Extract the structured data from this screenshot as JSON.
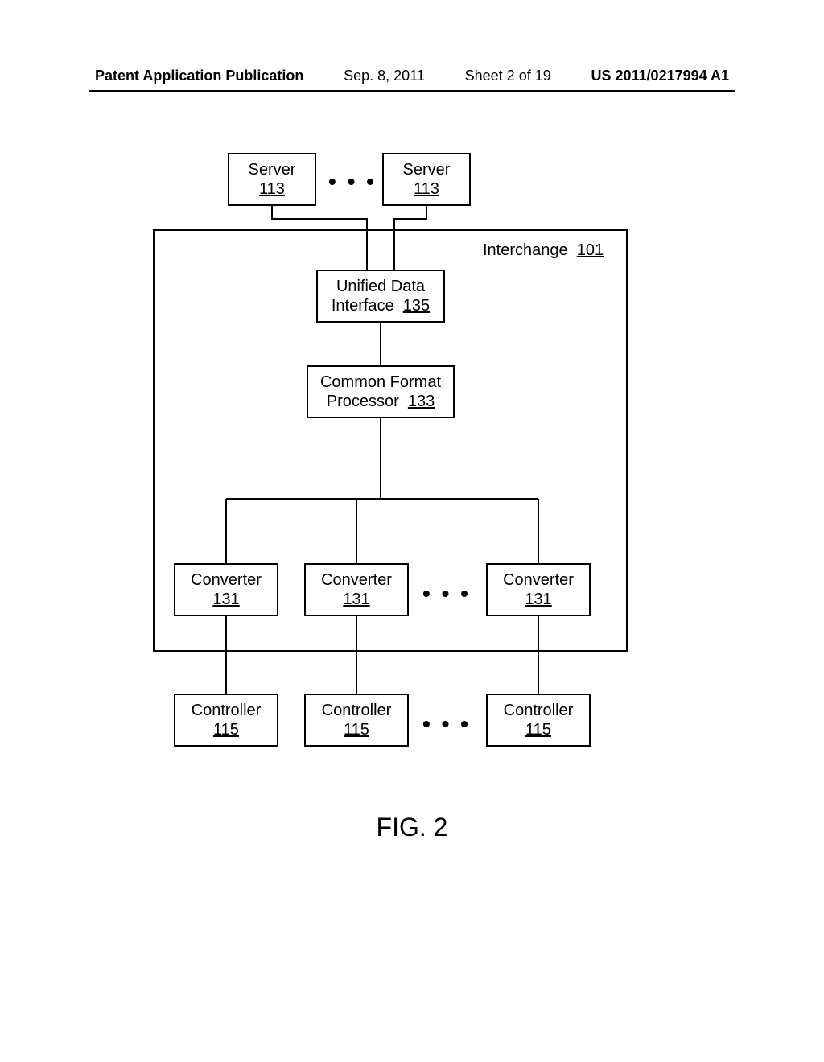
{
  "header": {
    "pub_label": "Patent Application Publication",
    "date": "Sep. 8, 2011",
    "sheet": "Sheet 2 of 19",
    "pubnum": "US 2011/0217994 A1"
  },
  "figure_caption": "FIG. 2",
  "interchange": {
    "label": "Interchange",
    "ref": "101"
  },
  "servers": [
    {
      "label": "Server",
      "ref": "113"
    },
    {
      "label": "Server",
      "ref": "113"
    }
  ],
  "unified_data_interface": {
    "label_line1": "Unified Data",
    "label_line2": "Interface",
    "ref": "135"
  },
  "common_format_processor": {
    "label_line1": "Common Format",
    "label_line2": "Processor",
    "ref": "133"
  },
  "converters": [
    {
      "label": "Converter",
      "ref": "131"
    },
    {
      "label": "Converter",
      "ref": "131"
    },
    {
      "label": "Converter",
      "ref": "131"
    }
  ],
  "controllers": [
    {
      "label": "Controller",
      "ref": "115"
    },
    {
      "label": "Controller",
      "ref": "115"
    },
    {
      "label": "Controller",
      "ref": "115"
    }
  ],
  "ellipsis": "• • •"
}
